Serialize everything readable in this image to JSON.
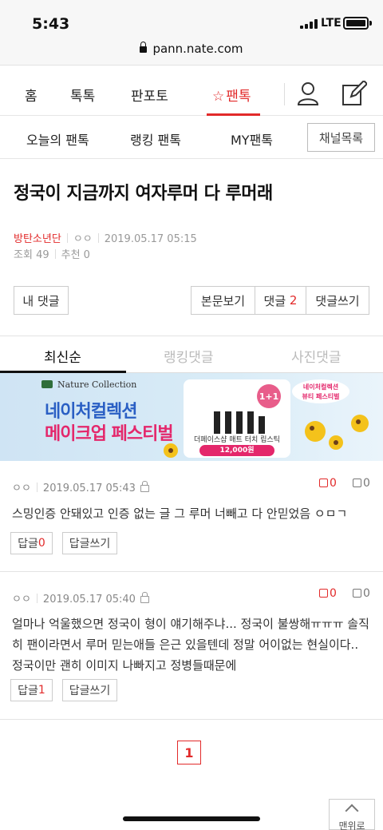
{
  "status_bar": {
    "time": "5:43",
    "network": "LTE"
  },
  "browser": {
    "url": "pann.nate.com"
  },
  "main_nav": {
    "items": [
      "홈",
      "톡톡",
      "판포토",
      "팬톡"
    ]
  },
  "sub_nav": {
    "items": [
      "오늘의 팬톡",
      "랭킹 팬톡",
      "MY팬톡"
    ],
    "channel_button": "채널목록"
  },
  "post": {
    "title": "정국이 지금까지 여자루머 다 루머래",
    "category": "방탄소년단",
    "author": "ㅇㅇ",
    "date": "2019.05.17 05:15",
    "views_label": "조회",
    "views": "49",
    "recommend_label": "추천",
    "recommend": "0"
  },
  "actions": {
    "my_comments": "내 댓글",
    "view_post": "본문보기",
    "comments_label": "댓글",
    "comments_count": "2",
    "write_comment": "댓글쓰기"
  },
  "tabs": [
    "최신순",
    "랭킹댓글",
    "사진댓글"
  ],
  "banner": {
    "brand": "Nature Collection",
    "line1": "네이처컬렉션",
    "line2": "메이크업 페스티벌",
    "badge": "1+1",
    "product_name": "더페이스샵 매트 터치 립스틱",
    "price": "12,000원",
    "sticker_line1": "네이처컬렉션",
    "sticker_line2": "뷰티 페스티벌"
  },
  "comments": [
    {
      "author": "ㅇㅇ",
      "date": "2019.05.17 05:43",
      "up": "0",
      "down": "0",
      "body": "스밍인증 안돼있고 인증 없는 글 그 루머 너빼고 다 안믿었음 ㅇㅁㄱ",
      "reply_label": "답글",
      "reply_count": "0",
      "write_reply": "답글쓰기"
    },
    {
      "author": "ㅇㅇ",
      "date": "2019.05.17 05:40",
      "up": "0",
      "down": "0",
      "body": "얼마나 억울했으면 정국이 형이 얘기해주냐... 정국이 불쌍해ㅠㅠㅠ 솔직히 팬이라면서 루머 믿는애들 은근 있을텐데 정말 어이없는 현실이다.. 정국이만 괜히 이미지 나빠지고 정병들때문에",
      "reply_label": "답글",
      "reply_count": "1",
      "write_reply": "답글쓰기"
    }
  ],
  "pagination": {
    "current": "1"
  },
  "to_top": "맨위로",
  "colors": {
    "accent": "#e22a2a",
    "banner_blue": "#2a5fc4",
    "banner_pink": "#e4276b"
  }
}
